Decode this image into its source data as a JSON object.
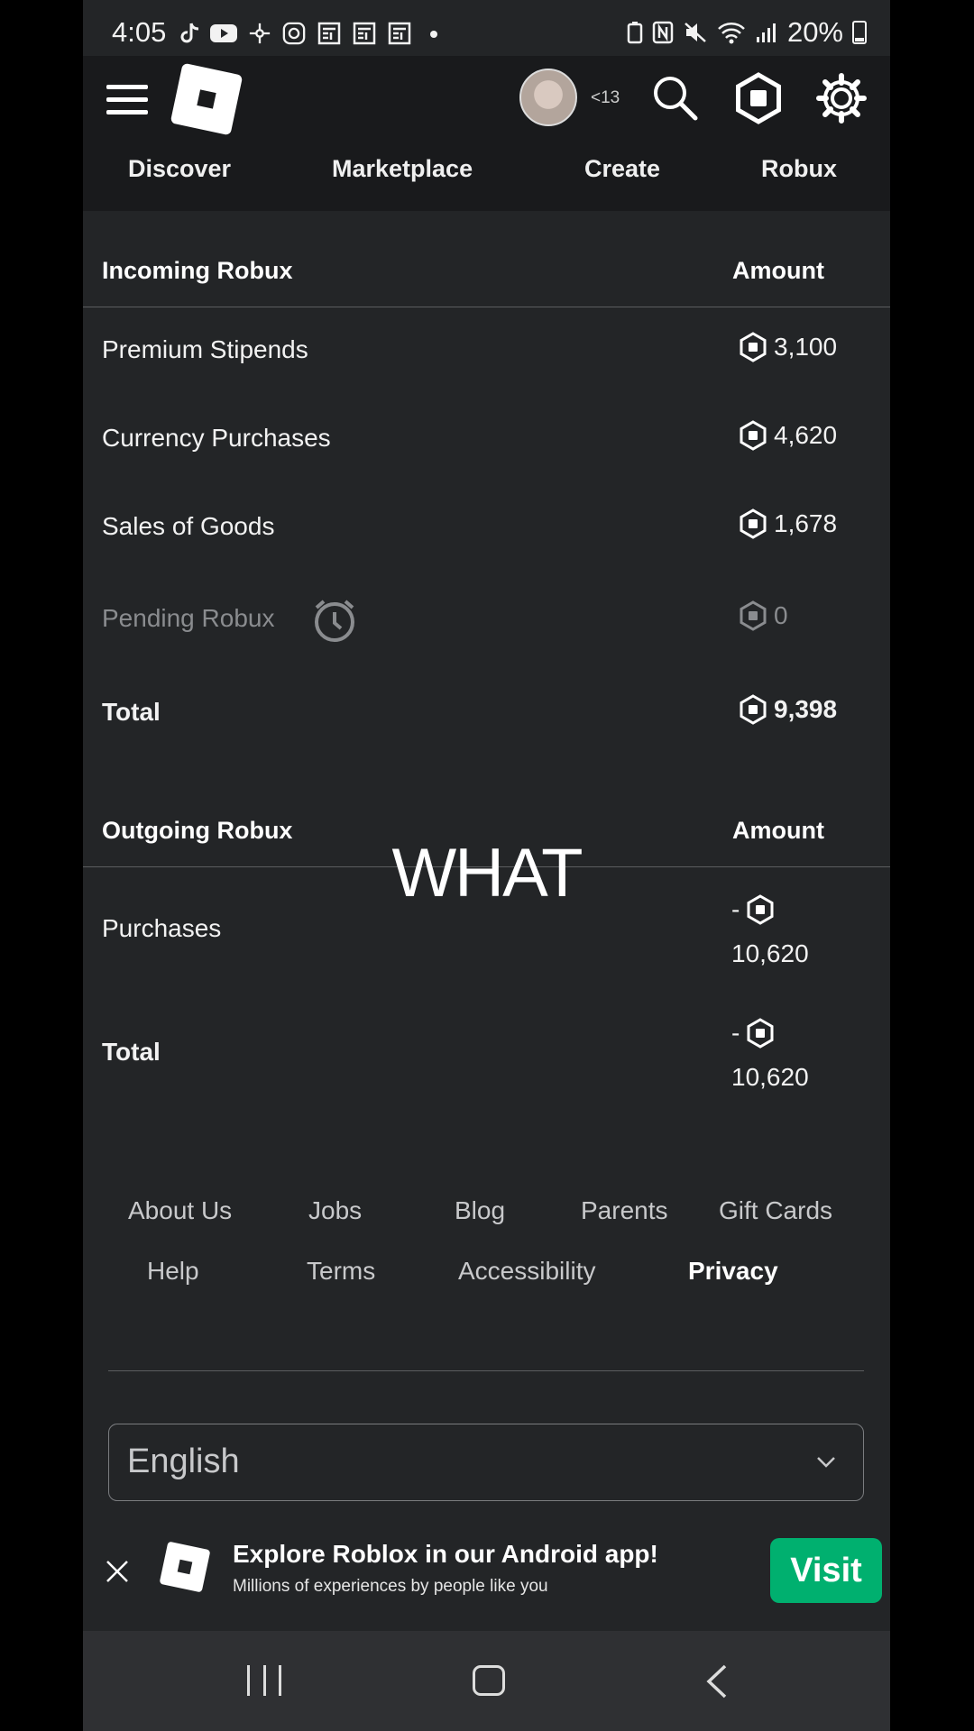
{
  "status_bar": {
    "time": "4:05",
    "battery": "20%",
    "left_icons": [
      "tiktok-icon",
      "youtube-icon",
      "pinwheel-icon",
      "instagram-icon",
      "news-icon",
      "news-icon",
      "news-icon",
      "dot-icon"
    ],
    "right_icons": [
      "battery-saver-icon",
      "nfc-icon",
      "mute-icon",
      "wifi-icon",
      "signal-icon",
      "battery-icon"
    ]
  },
  "header": {
    "age_label": "<13",
    "nav": [
      "Discover",
      "Marketplace",
      "Create",
      "Robux"
    ]
  },
  "incoming": {
    "heading": "Incoming Robux",
    "amount_heading": "Amount",
    "rows": [
      {
        "label": "Premium Stipends",
        "amount": "3,100"
      },
      {
        "label": "Currency Purchases",
        "amount": "4,620"
      },
      {
        "label": "Sales of Goods",
        "amount": "1,678"
      },
      {
        "label": "Pending Robux",
        "amount": "0"
      }
    ],
    "total_label": "Total",
    "total_amount": "9,398"
  },
  "outgoing": {
    "heading": "Outgoing Robux",
    "amount_heading": "Amount",
    "rows": [
      {
        "label": "Purchases",
        "sign": "-",
        "amount": "10,620"
      }
    ],
    "total_label": "Total",
    "total_sign": "-",
    "total_amount": "10,620"
  },
  "overlay_caption": "WHAT",
  "footer": {
    "links_row1": [
      "About Us",
      "Jobs",
      "Blog",
      "Parents",
      "Gift Cards"
    ],
    "links_row2": [
      "Help",
      "Terms",
      "Accessibility",
      "Privacy"
    ],
    "language": "English"
  },
  "banner": {
    "title": "Explore Roblox in our Android app!",
    "subtitle": "Millions of experiences by people like you",
    "visit_label": "Visit"
  },
  "colors": {
    "background": "#232527",
    "header": "#191a1c",
    "visit_button": "#00b06f"
  }
}
